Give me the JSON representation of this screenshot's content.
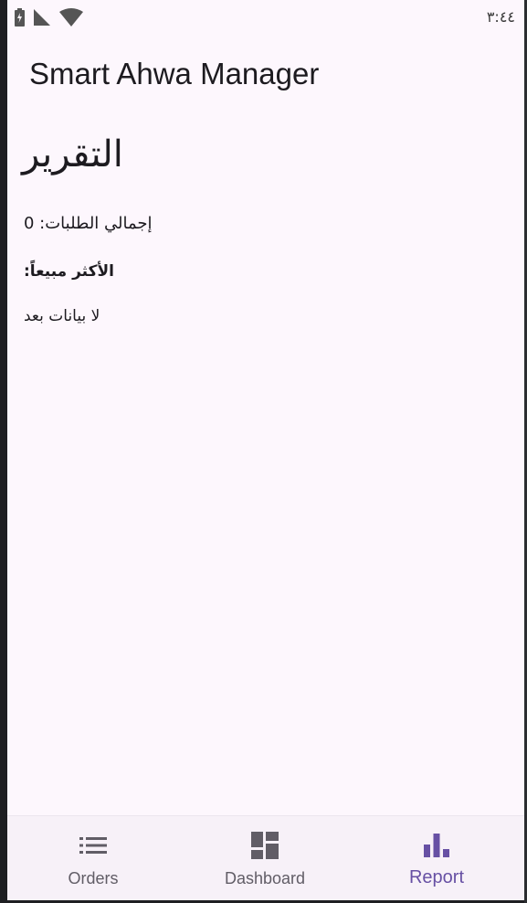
{
  "status_bar": {
    "time": "٣:٤٤",
    "icons": [
      "battery-charging-icon",
      "cell-signal-icon",
      "wifi-icon"
    ]
  },
  "app_bar": {
    "title": "Smart Ahwa Manager"
  },
  "report": {
    "heading": "التقرير",
    "total_orders_label": "إجمالي الطلبات: 0",
    "best_seller_label": "الأكثر مبيعاً:",
    "no_data_text": "لا بيانات بعد"
  },
  "bottom_nav": {
    "items": [
      {
        "label": "Orders",
        "icon": "list-icon",
        "active": false
      },
      {
        "label": "Dashboard",
        "icon": "dashboard-icon",
        "active": false
      },
      {
        "label": "Report",
        "icon": "bar-chart-icon",
        "active": true
      }
    ]
  },
  "colors": {
    "background": "#fdf7fd",
    "nav_background": "#f7f1f8",
    "accent": "#6750a4",
    "inactive": "#615d66",
    "text": "#1d1b20"
  }
}
